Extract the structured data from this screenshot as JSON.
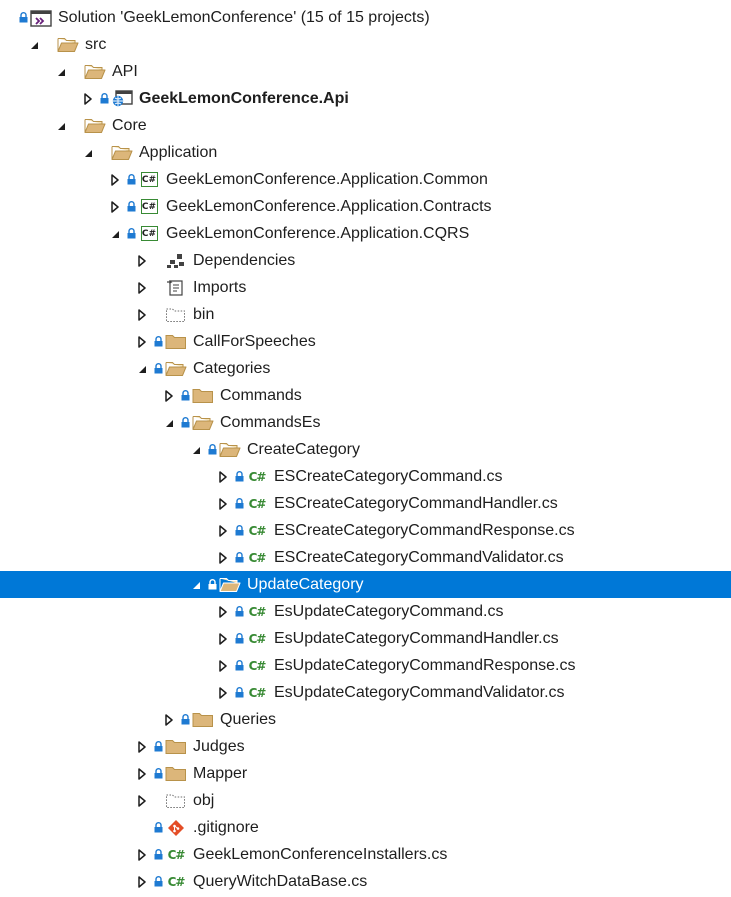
{
  "colors": {
    "selection": "#0078d7",
    "folder": "#dcb67a",
    "lock": "#1e7ad2",
    "csharp": "#388a34",
    "git": "#e44d26"
  },
  "tree": [
    {
      "label": "Solution 'GeekLemonConference' (15 of 15 projects)",
      "depth": 0,
      "expander": "none",
      "lock": true,
      "icon": "solution-icon"
    },
    {
      "label": "src",
      "depth": 1,
      "expander": "expanded",
      "lock": false,
      "icon": "folder-open-icon"
    },
    {
      "label": "API",
      "depth": 2,
      "expander": "expanded",
      "lock": false,
      "icon": "folder-open-icon"
    },
    {
      "label": "GeekLemonConference.Api",
      "depth": 3,
      "expander": "collapsed",
      "lock": true,
      "icon": "web-project-icon",
      "bold": true
    },
    {
      "label": "Core",
      "depth": 2,
      "expander": "expanded",
      "lock": false,
      "icon": "folder-open-icon"
    },
    {
      "label": "Application",
      "depth": 3,
      "expander": "expanded",
      "lock": false,
      "icon": "folder-open-icon"
    },
    {
      "label": "GeekLemonConference.Application.Common",
      "depth": 4,
      "expander": "collapsed",
      "lock": true,
      "icon": "csharp-project-icon"
    },
    {
      "label": "GeekLemonConference.Application.Contracts",
      "depth": 4,
      "expander": "collapsed",
      "lock": true,
      "icon": "csharp-project-icon"
    },
    {
      "label": "GeekLemonConference.Application.CQRS",
      "depth": 4,
      "expander": "expanded",
      "lock": true,
      "icon": "csharp-project-icon"
    },
    {
      "label": "Dependencies",
      "depth": 5,
      "expander": "collapsed",
      "lock": false,
      "icon": "dependencies-icon"
    },
    {
      "label": "Imports",
      "depth": 5,
      "expander": "collapsed",
      "lock": false,
      "icon": "imports-icon"
    },
    {
      "label": "bin",
      "depth": 5,
      "expander": "collapsed",
      "lock": false,
      "icon": "folder-excluded-icon"
    },
    {
      "label": "CallForSpeeches",
      "depth": 5,
      "expander": "collapsed",
      "lock": true,
      "icon": "folder-icon"
    },
    {
      "label": "Categories",
      "depth": 5,
      "expander": "expanded",
      "lock": true,
      "icon": "folder-open-icon"
    },
    {
      "label": "Commands",
      "depth": 6,
      "expander": "collapsed",
      "lock": true,
      "icon": "folder-icon"
    },
    {
      "label": "CommandsEs",
      "depth": 6,
      "expander": "expanded",
      "lock": true,
      "icon": "folder-open-icon"
    },
    {
      "label": "CreateCategory",
      "depth": 7,
      "expander": "expanded",
      "lock": true,
      "icon": "folder-open-icon"
    },
    {
      "label": "ESCreateCategoryCommand.cs",
      "depth": 8,
      "expander": "collapsed",
      "lock": true,
      "icon": "csharp-file-icon"
    },
    {
      "label": "ESCreateCategoryCommandHandler.cs",
      "depth": 8,
      "expander": "collapsed",
      "lock": true,
      "icon": "csharp-file-icon"
    },
    {
      "label": "ESCreateCategoryCommandResponse.cs",
      "depth": 8,
      "expander": "collapsed",
      "lock": true,
      "icon": "csharp-file-icon"
    },
    {
      "label": "ESCreateCategoryCommandValidator.cs",
      "depth": 8,
      "expander": "collapsed",
      "lock": true,
      "icon": "csharp-file-icon"
    },
    {
      "label": "UpdateCategory",
      "depth": 7,
      "expander": "expanded",
      "lock": true,
      "icon": "folder-open-icon",
      "selected": true
    },
    {
      "label": "EsUpdateCategoryCommand.cs",
      "depth": 8,
      "expander": "collapsed",
      "lock": true,
      "icon": "csharp-file-icon"
    },
    {
      "label": "EsUpdateCategoryCommandHandler.cs",
      "depth": 8,
      "expander": "collapsed",
      "lock": true,
      "icon": "csharp-file-icon"
    },
    {
      "label": "EsUpdateCategoryCommandResponse.cs",
      "depth": 8,
      "expander": "collapsed",
      "lock": true,
      "icon": "csharp-file-icon"
    },
    {
      "label": "EsUpdateCategoryCommandValidator.cs",
      "depth": 8,
      "expander": "collapsed",
      "lock": true,
      "icon": "csharp-file-icon"
    },
    {
      "label": "Queries",
      "depth": 6,
      "expander": "collapsed",
      "lock": true,
      "icon": "folder-icon"
    },
    {
      "label": "Judges",
      "depth": 5,
      "expander": "collapsed",
      "lock": true,
      "icon": "folder-icon"
    },
    {
      "label": "Mapper",
      "depth": 5,
      "expander": "collapsed",
      "lock": true,
      "icon": "folder-icon"
    },
    {
      "label": "obj",
      "depth": 5,
      "expander": "collapsed",
      "lock": false,
      "icon": "folder-excluded-icon"
    },
    {
      "label": ".gitignore",
      "depth": 5,
      "expander": "none",
      "lock": true,
      "icon": "git-icon"
    },
    {
      "label": "GeekLemonConferenceInstallers.cs",
      "depth": 5,
      "expander": "collapsed",
      "lock": true,
      "icon": "csharp-file-icon"
    },
    {
      "label": "QueryWitchDataBase.cs",
      "depth": 5,
      "expander": "collapsed",
      "lock": true,
      "icon": "csharp-file-icon"
    }
  ]
}
